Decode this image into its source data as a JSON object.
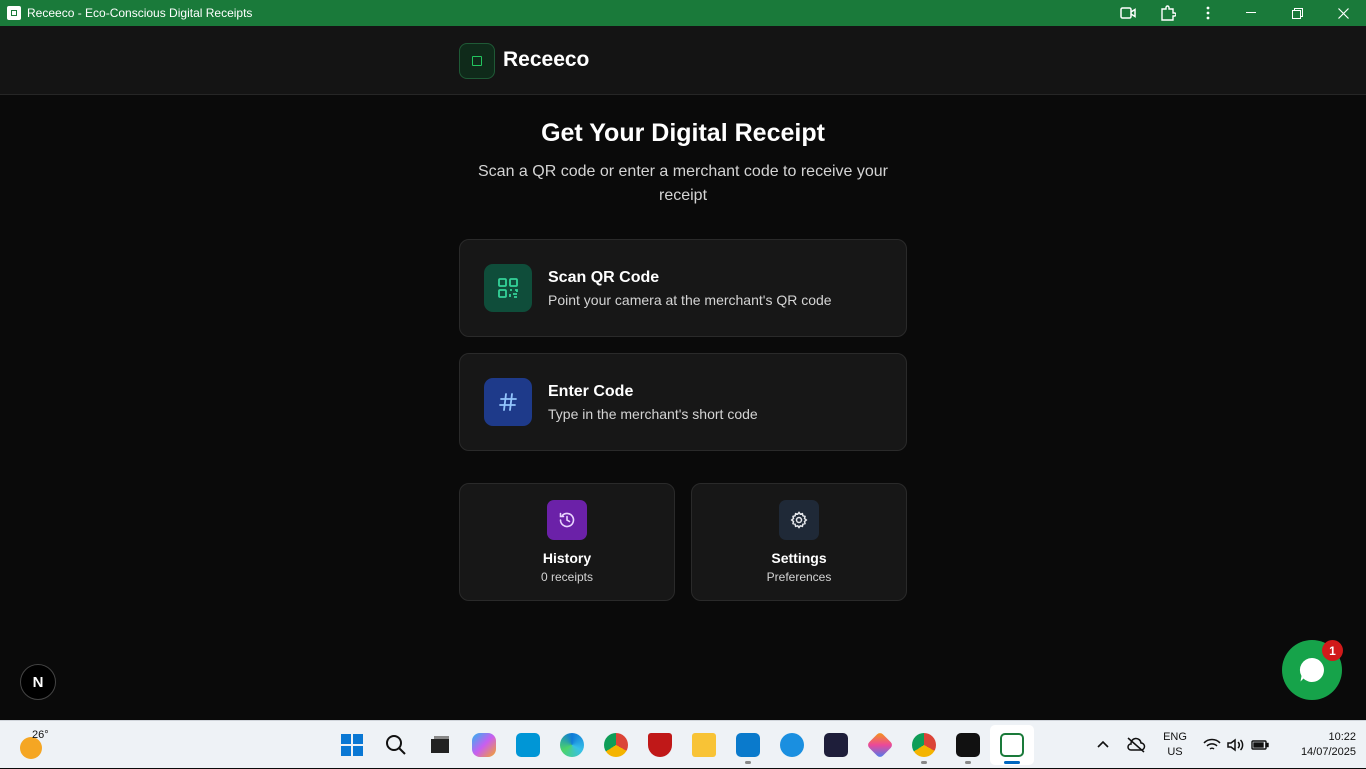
{
  "window": {
    "title": "Receeco - Eco-Conscious Digital Receipts"
  },
  "header": {
    "brand": "Receeco"
  },
  "main": {
    "title": "Get Your Digital Receipt",
    "subtitle": "Scan a QR code or enter a merchant code to receive your receipt",
    "actions": [
      {
        "title": "Scan QR Code",
        "description": "Point your camera at the merchant's QR code",
        "icon": "qr-code-icon",
        "color": "#0f4d3a"
      },
      {
        "title": "Enter Code",
        "description": "Type in the merchant's short code",
        "icon": "hash-icon",
        "color": "#1e3a8a"
      }
    ],
    "tiles": [
      {
        "title": "History",
        "description": "0 receipts",
        "icon": "history-icon",
        "color": "#6b21a8"
      },
      {
        "title": "Settings",
        "description": "Preferences",
        "icon": "gear-icon",
        "color": "#1f2937"
      }
    ]
  },
  "floating": {
    "next_badge": "N",
    "chat_badge_count": "1"
  },
  "taskbar": {
    "temperature": "26°",
    "language_line1": "ENG",
    "language_line2": "US",
    "time": "10:22",
    "date": "14/07/2025",
    "apps": [
      "windows-start-icon",
      "search-icon",
      "task-view-icon",
      "copilot-icon",
      "myhp-icon",
      "edge-icon",
      "chrome-icon",
      "mcafee-icon",
      "file-explorer-icon",
      "vscode-icon",
      "help-icon",
      "ui-app-icon",
      "git-icon",
      "chrome-profile-icon",
      "cube-app-icon",
      "receeco-app-icon"
    ]
  }
}
